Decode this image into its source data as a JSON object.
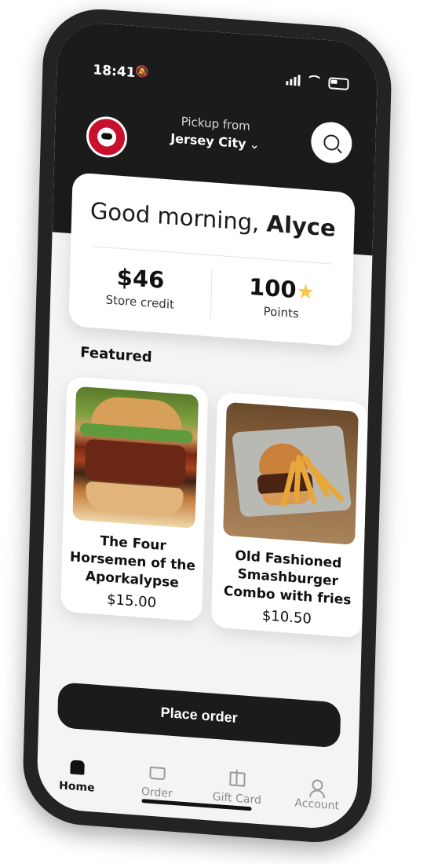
{
  "status_bar": {
    "time": "18:41",
    "bell_icon": "bell-slash-icon"
  },
  "header": {
    "pickup_label": "Pickup from",
    "location": "Jersey City",
    "location_chevron": "⌄"
  },
  "greeting": {
    "prefix": "Good morning, ",
    "name": "Alyce"
  },
  "stats": {
    "credit_value": "$46",
    "credit_label": "Store credit",
    "points_value": "100",
    "points_label": "Points"
  },
  "featured": {
    "title": "Featured",
    "items": [
      {
        "name": "The Four Horsemen of the Aporkalypse",
        "price": "$15.00"
      },
      {
        "name": "Old Fashioned Smashburger Combo with fries",
        "price": "$10.50"
      }
    ]
  },
  "actions": {
    "place_order": "Place order"
  },
  "tabs": [
    {
      "label": "Home"
    },
    {
      "label": "Order"
    },
    {
      "label": "Gift Card"
    },
    {
      "label": "Account"
    }
  ],
  "colors": {
    "dark": "#1b1b1b",
    "star": "#f6c84c",
    "brand_red": "#c8102e"
  }
}
